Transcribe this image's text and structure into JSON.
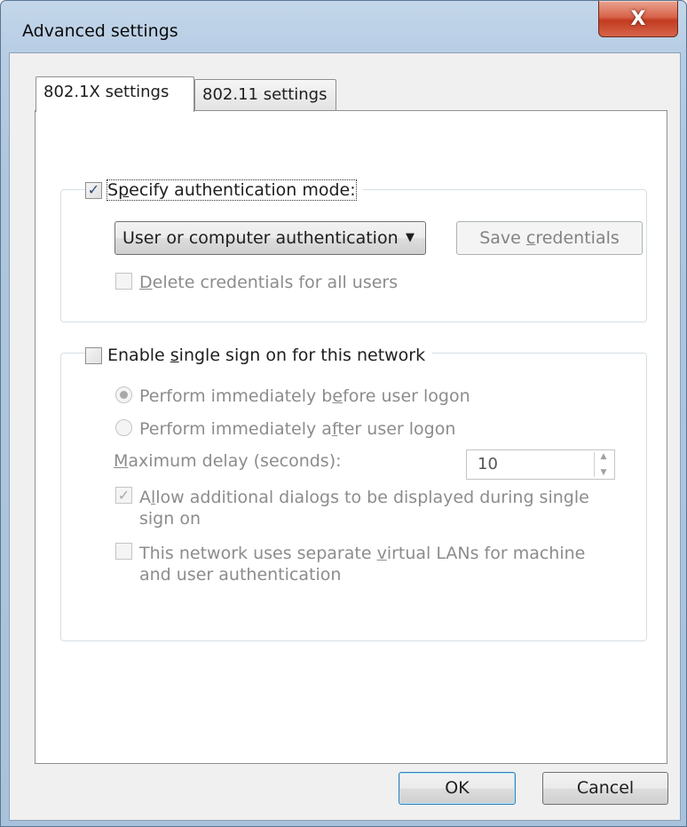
{
  "window": {
    "title": "Advanced settings",
    "close_label": "X"
  },
  "tabs": [
    {
      "label": "802.1X settings",
      "active": true
    },
    {
      "label": "802.11 settings",
      "active": false
    }
  ],
  "auth_group": {
    "checkbox_label_pre": "S",
    "checkbox_label_key": "p",
    "checkbox_label_post": "ecify authentication mode:",
    "checked": true,
    "dropdown_value": "User or computer authentication",
    "save_button_pre": "Save ",
    "save_button_key": "c",
    "save_button_post": "redentials",
    "delete_key": "D",
    "delete_label_post": "elete credentials for all users"
  },
  "sso_group": {
    "checkbox_pre": "Enable ",
    "checkbox_key": "s",
    "checkbox_post": "ingle sign on for this network",
    "checked": false,
    "radio_before_pre": "Perform immediately b",
    "radio_before_key": "e",
    "radio_before_post": "fore user logon",
    "radio_after_pre": "Perform immediately a",
    "radio_after_key": "f",
    "radio_after_post": "ter user logon",
    "delay_key": "M",
    "delay_label_post": "aximum delay (seconds):",
    "delay_value": "10",
    "allow_pre": "A",
    "allow_key": "l",
    "allow_post": "low additional dialogs to be displayed during single",
    "allow_line2": "sign on",
    "allow_checked": true,
    "vlan_pre": "This network uses separate ",
    "vlan_key": "v",
    "vlan_post": "irtual LANs for machine",
    "vlan_line2": "and user authentication",
    "vlan_checked": false
  },
  "footer": {
    "ok_label": "OK",
    "cancel_label": "Cancel"
  },
  "colors": {
    "title_bar": "#b7cde4",
    "close_button": "#c23b20",
    "disabled_text": "#8c8c8c"
  }
}
